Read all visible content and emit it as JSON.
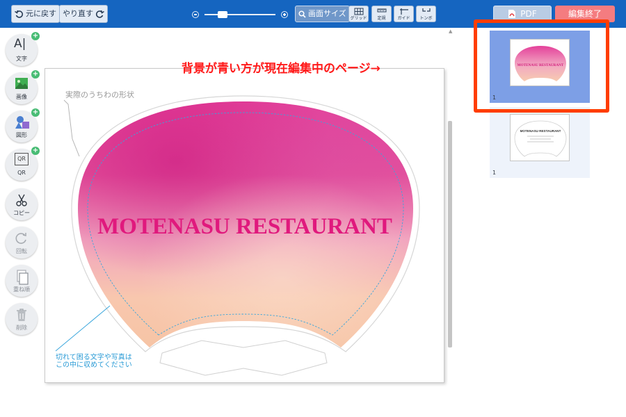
{
  "toolbar": {
    "undo_label": "元に戻す",
    "redo_label": "やり直す",
    "screen_size_label": "画面サイズ",
    "grid_label": "グリッド",
    "ruler_label": "定規",
    "guide_label": "ガイド",
    "trim_label": "トンボ",
    "pdf_label": "PDF",
    "finish_label": "編集終了",
    "zoom_level": 0.22
  },
  "left_tools": {
    "text": "文字",
    "image": "画像",
    "shape": "図形",
    "qr": "QR",
    "copy": "コピー",
    "rotate": "回転",
    "layer": "重ね順",
    "delete": "削除"
  },
  "icons": {
    "text_glyph": "A|",
    "qr_glyph": "QR",
    "plus_glyph": "+"
  },
  "canvas": {
    "shape_label": "実際のうちわの形状",
    "safe_area_line1": "切れて困る文字や写真は",
    "safe_area_line2": "この中に収めてください",
    "design_title": "MOTENASU RESTAURANT"
  },
  "annotation": {
    "notice_text": "背景が青い方が現在編集中のページ→"
  },
  "pages": [
    {
      "number": "1",
      "title": "MOTENASU RESTAURANT",
      "active": true
    },
    {
      "number": "1",
      "title": "MOTENASU RESTAURANT",
      "active": false
    }
  ],
  "colors": {
    "toolbar_bg": "#1565c0",
    "active_thumb_bg": "#7d9fe6",
    "highlight": "#ff3d00",
    "notice": "#ff1a1a",
    "title_pink": "#e0197d",
    "finish_btn": "#f47c80",
    "plus_badge": "#48bc74",
    "safe_guide": "#2a9bd6"
  }
}
